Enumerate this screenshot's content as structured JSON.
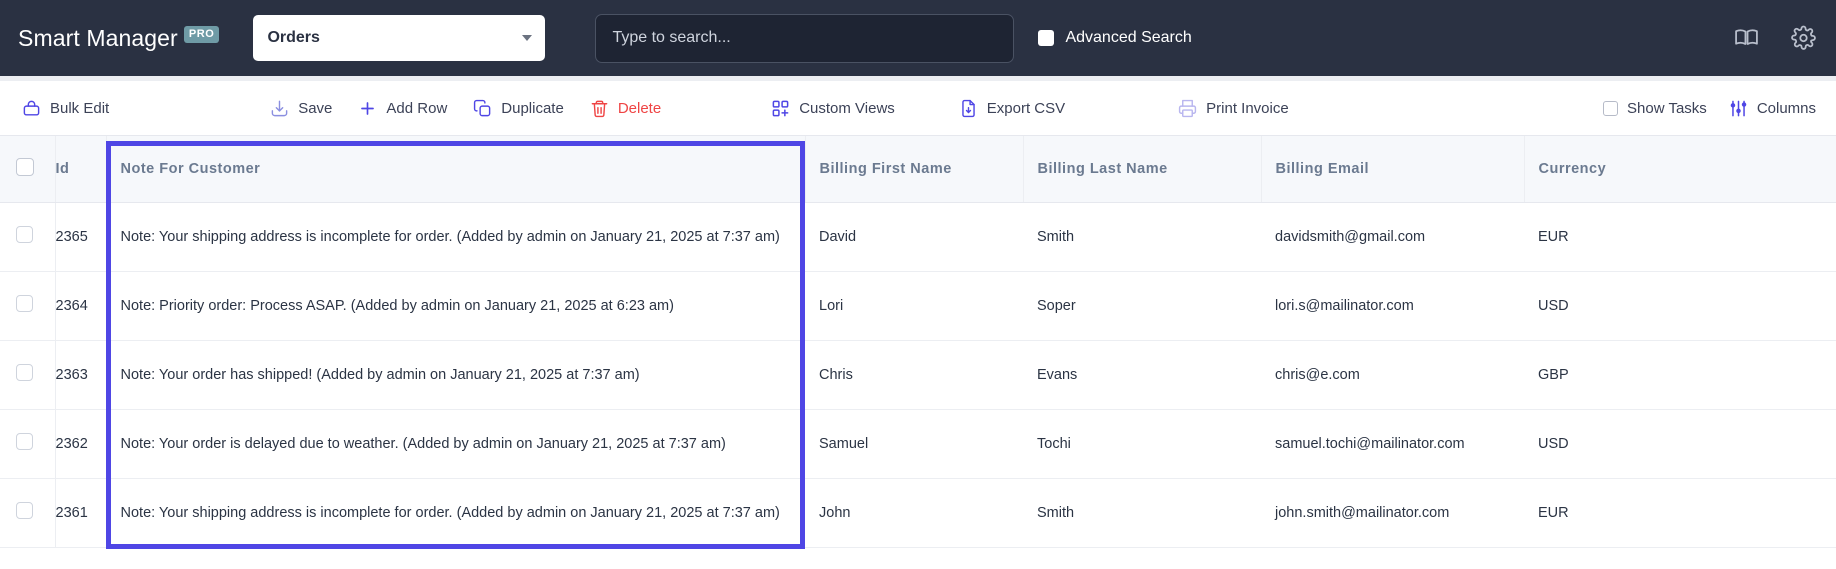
{
  "header": {
    "brand_name": "Smart Manager",
    "brand_badge": "PRO",
    "dashboard_select": {
      "value": "Orders",
      "icon": "chevron-down-icon"
    },
    "search": {
      "placeholder": "Type to search...",
      "value": ""
    },
    "advanced_search": {
      "label": "Advanced Search",
      "checked": false
    },
    "icons": [
      {
        "name": "book-icon",
        "label": "Documentation"
      },
      {
        "name": "gear-icon",
        "label": "Settings"
      }
    ],
    "bg_color": "#2a3142",
    "badge_color": "#6f9ba6"
  },
  "toolbar": {
    "bulk_edit": {
      "label": "Bulk Edit",
      "icon": "bulk-edit-icon"
    },
    "save": {
      "label": "Save",
      "icon": "save-icon"
    },
    "add_row": {
      "label": "Add Row",
      "icon": "plus-icon"
    },
    "duplicate": {
      "label": "Duplicate",
      "icon": "duplicate-icon"
    },
    "delete": {
      "label": "Delete",
      "icon": "trash-icon",
      "color": "#ef4444"
    },
    "custom_views": {
      "label": "Custom Views",
      "icon": "custom-views-icon"
    },
    "export_csv": {
      "label": "Export CSV",
      "icon": "export-csv-icon"
    },
    "print_invoice": {
      "label": "Print Invoice",
      "icon": "printer-icon"
    },
    "show_tasks": {
      "label": "Show Tasks",
      "checked": false
    },
    "columns": {
      "label": "Columns",
      "icon": "sliders-icon"
    },
    "accent_color": "#4f46e5"
  },
  "table": {
    "columns": [
      {
        "key": "select",
        "label": ""
      },
      {
        "key": "id",
        "label": "Id"
      },
      {
        "key": "note",
        "label": "Note For Customer"
      },
      {
        "key": "billing_first_name",
        "label": "Billing First Name"
      },
      {
        "key": "billing_last_name",
        "label": "Billing Last Name"
      },
      {
        "key": "billing_email",
        "label": "Billing Email"
      },
      {
        "key": "currency",
        "label": "Currency"
      }
    ],
    "highlighted_column": "Note For Customer",
    "highlight_color": "#4f46e5",
    "rows": [
      {
        "id": "2365",
        "note": "Note: Your shipping address is incomplete for order. (Added by admin on January 21, 2025 at 7:37 am)",
        "billing_first_name": "David",
        "billing_last_name": "Smith",
        "billing_email": "davidsmith@gmail.com",
        "currency": "EUR",
        "selected": false
      },
      {
        "id": "2364",
        "note": "Note: Priority order: Process ASAP. (Added by admin on January 21, 2025 at 6:23 am)",
        "billing_first_name": "Lori",
        "billing_last_name": "Soper",
        "billing_email": "lori.s@mailinator.com",
        "currency": "USD",
        "selected": false
      },
      {
        "id": "2363",
        "note": "Note: Your order has shipped! (Added by admin on January 21, 2025 at 7:37 am)",
        "billing_first_name": "Chris",
        "billing_last_name": "Evans",
        "billing_email": "chris@e.com",
        "currency": "GBP",
        "selected": false
      },
      {
        "id": "2362",
        "note": "Note: Your order is delayed due to weather. (Added by admin on January 21, 2025 at 7:37 am)",
        "billing_first_name": "Samuel",
        "billing_last_name": "Tochi",
        "billing_email": "samuel.tochi@mailinator.com",
        "currency": "USD",
        "selected": false
      },
      {
        "id": "2361",
        "note": "Note: Your shipping address is incomplete for order. (Added by admin on January 21, 2025 at 7:37 am)",
        "billing_first_name": "John",
        "billing_last_name": "Smith",
        "billing_email": "john.smith@mailinator.com",
        "currency": "EUR",
        "selected": false
      }
    ]
  }
}
